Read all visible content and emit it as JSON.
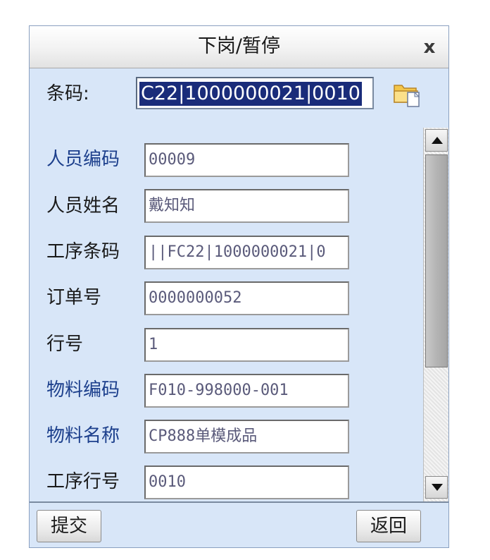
{
  "dialog": {
    "title": "下岗/暂停",
    "close_label": "x"
  },
  "barcode": {
    "label": "条码:",
    "value": "C22|1000000021|0010"
  },
  "fields": [
    {
      "label": "人员编码",
      "value": "00009"
    },
    {
      "label": "人员姓名",
      "value": "戴知知"
    },
    {
      "label": "工序条码",
      "value": "||FC22|1000000021|0"
    },
    {
      "label": "订单号",
      "value": "0000000052"
    },
    {
      "label": "行号",
      "value": "1"
    },
    {
      "label": "物料编码",
      "value": "F010-998000-001"
    },
    {
      "label": "物料名称",
      "value": "CP888单模成品"
    },
    {
      "label": "工序行号",
      "value": "0010"
    }
  ],
  "buttons": {
    "submit_label": "提交",
    "back_label": "返回"
  },
  "icons": {
    "folder": "folder-open-icon",
    "scroll_up": "arrow-up-icon",
    "scroll_down": "arrow-down-icon"
  },
  "colors": {
    "dialog_bg": "#d8e6f8",
    "selection_bg": "#1a2c7a",
    "label_blue": "#1c3f8c"
  }
}
